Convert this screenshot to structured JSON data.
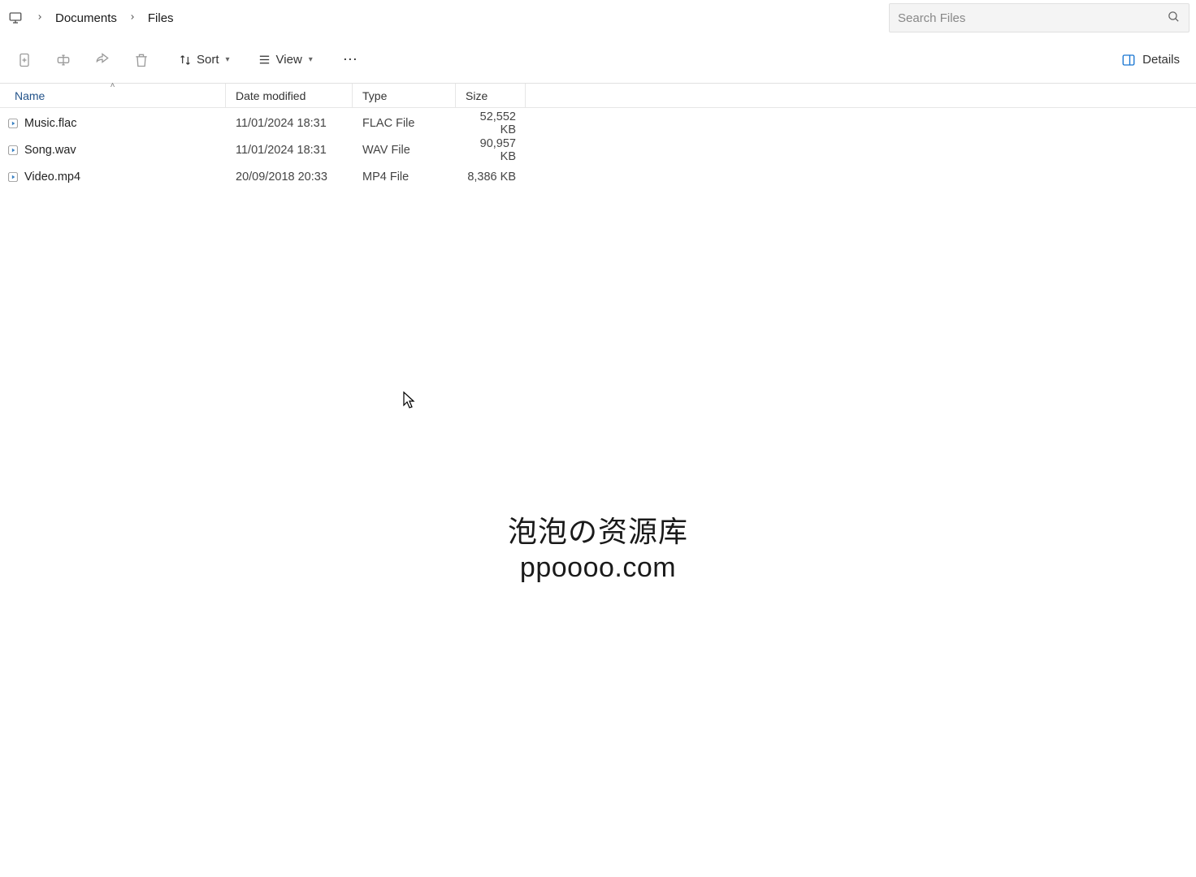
{
  "breadcrumb": {
    "items": [
      "Documents",
      "Files"
    ]
  },
  "search": {
    "placeholder": "Search Files"
  },
  "toolbar": {
    "sort_label": "Sort",
    "view_label": "View",
    "details_label": "Details"
  },
  "columns": {
    "name": "Name",
    "modified": "Date modified",
    "type": "Type",
    "size": "Size",
    "sorted_by": "name",
    "sort_direction": "asc"
  },
  "files": [
    {
      "name": "Music.flac",
      "modified": "11/01/2024 18:31",
      "type": "FLAC File",
      "size": "52,552 KB",
      "icon": "media"
    },
    {
      "name": "Song.wav",
      "modified": "11/01/2024 18:31",
      "type": "WAV File",
      "size": "90,957 KB",
      "icon": "media"
    },
    {
      "name": "Video.mp4",
      "modified": "20/09/2018 20:33",
      "type": "MP4 File",
      "size": "8,386 KB",
      "icon": "media"
    }
  ],
  "watermark": {
    "line1": "泡泡の资源库",
    "line2": "ppoooo.com"
  }
}
